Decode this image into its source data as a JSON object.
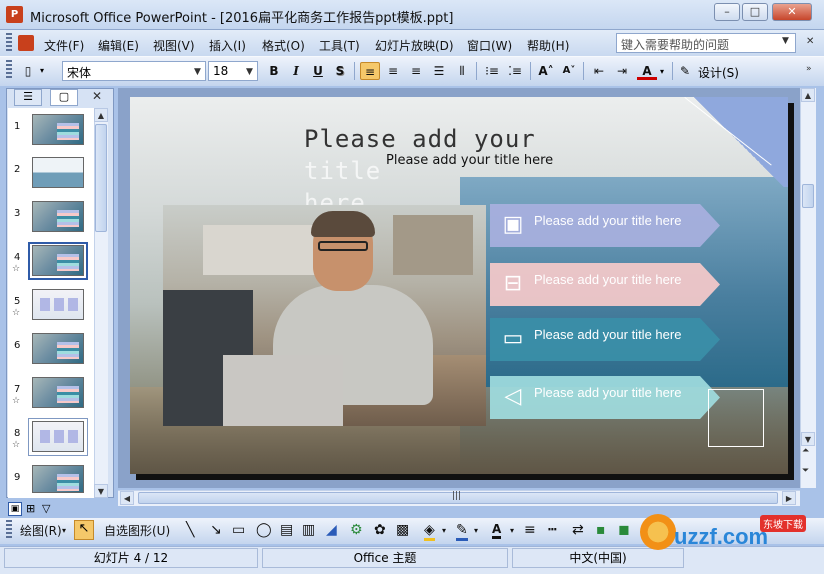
{
  "window": {
    "title": "Microsoft Office PowerPoint - [2016扁平化商务工作报告ppt模板.ppt]",
    "app_icon": "P",
    "minimize": "–",
    "maximize": "□",
    "close": "✕"
  },
  "menu": {
    "items": [
      "文件(F)",
      "编辑(E)",
      "视图(V)",
      "插入(I)",
      "格式(O)",
      "工具(T)",
      "幻灯片放映(D)",
      "窗口(W)",
      "帮助(H)"
    ],
    "help_placeholder": "键入需要帮助的问题"
  },
  "toolbar": {
    "font_name": "宋体",
    "font_size": "18",
    "bold": "B",
    "italic": "I",
    "underline": "U",
    "shadow": "S",
    "design_label": "设计(S)"
  },
  "panel": {
    "slides": [
      {
        "num": "1",
        "star": false
      },
      {
        "num": "2",
        "star": false
      },
      {
        "num": "3",
        "star": false
      },
      {
        "num": "4",
        "star": true
      },
      {
        "num": "5",
        "star": true
      },
      {
        "num": "6",
        "star": false
      },
      {
        "num": "7",
        "star": true
      },
      {
        "num": "8",
        "star": true
      },
      {
        "num": "9",
        "star": false
      }
    ],
    "star_glyph": "☆",
    "close": "✕"
  },
  "slide": {
    "title_dark": "Please add your",
    "title_faded_1": "title",
    "title_faded_2": "here",
    "subtitle": "Please add your title here",
    "cards": [
      {
        "text": "Please add your title here",
        "icon": "safe-icon",
        "color": "#a8b0de"
      },
      {
        "text": "Please add your title here",
        "icon": "briefcase-icon",
        "color": "#f6caca"
      },
      {
        "text": "Please add your title here",
        "icon": "computer-icon",
        "color": "#3a8ea8"
      },
      {
        "text": "Please add your title here",
        "icon": "megaphone-icon",
        "color": "#a0dcde"
      }
    ]
  },
  "drawing": {
    "draw_label": "绘图(R)",
    "autoshapes_label": "自选图形(U)"
  },
  "status": {
    "slide_info": "幻灯片 4 / 12",
    "theme": "Office 主题",
    "language": "中文(中国)"
  },
  "watermark": {
    "text": "uzzf.com",
    "tag": "东坡下载"
  }
}
